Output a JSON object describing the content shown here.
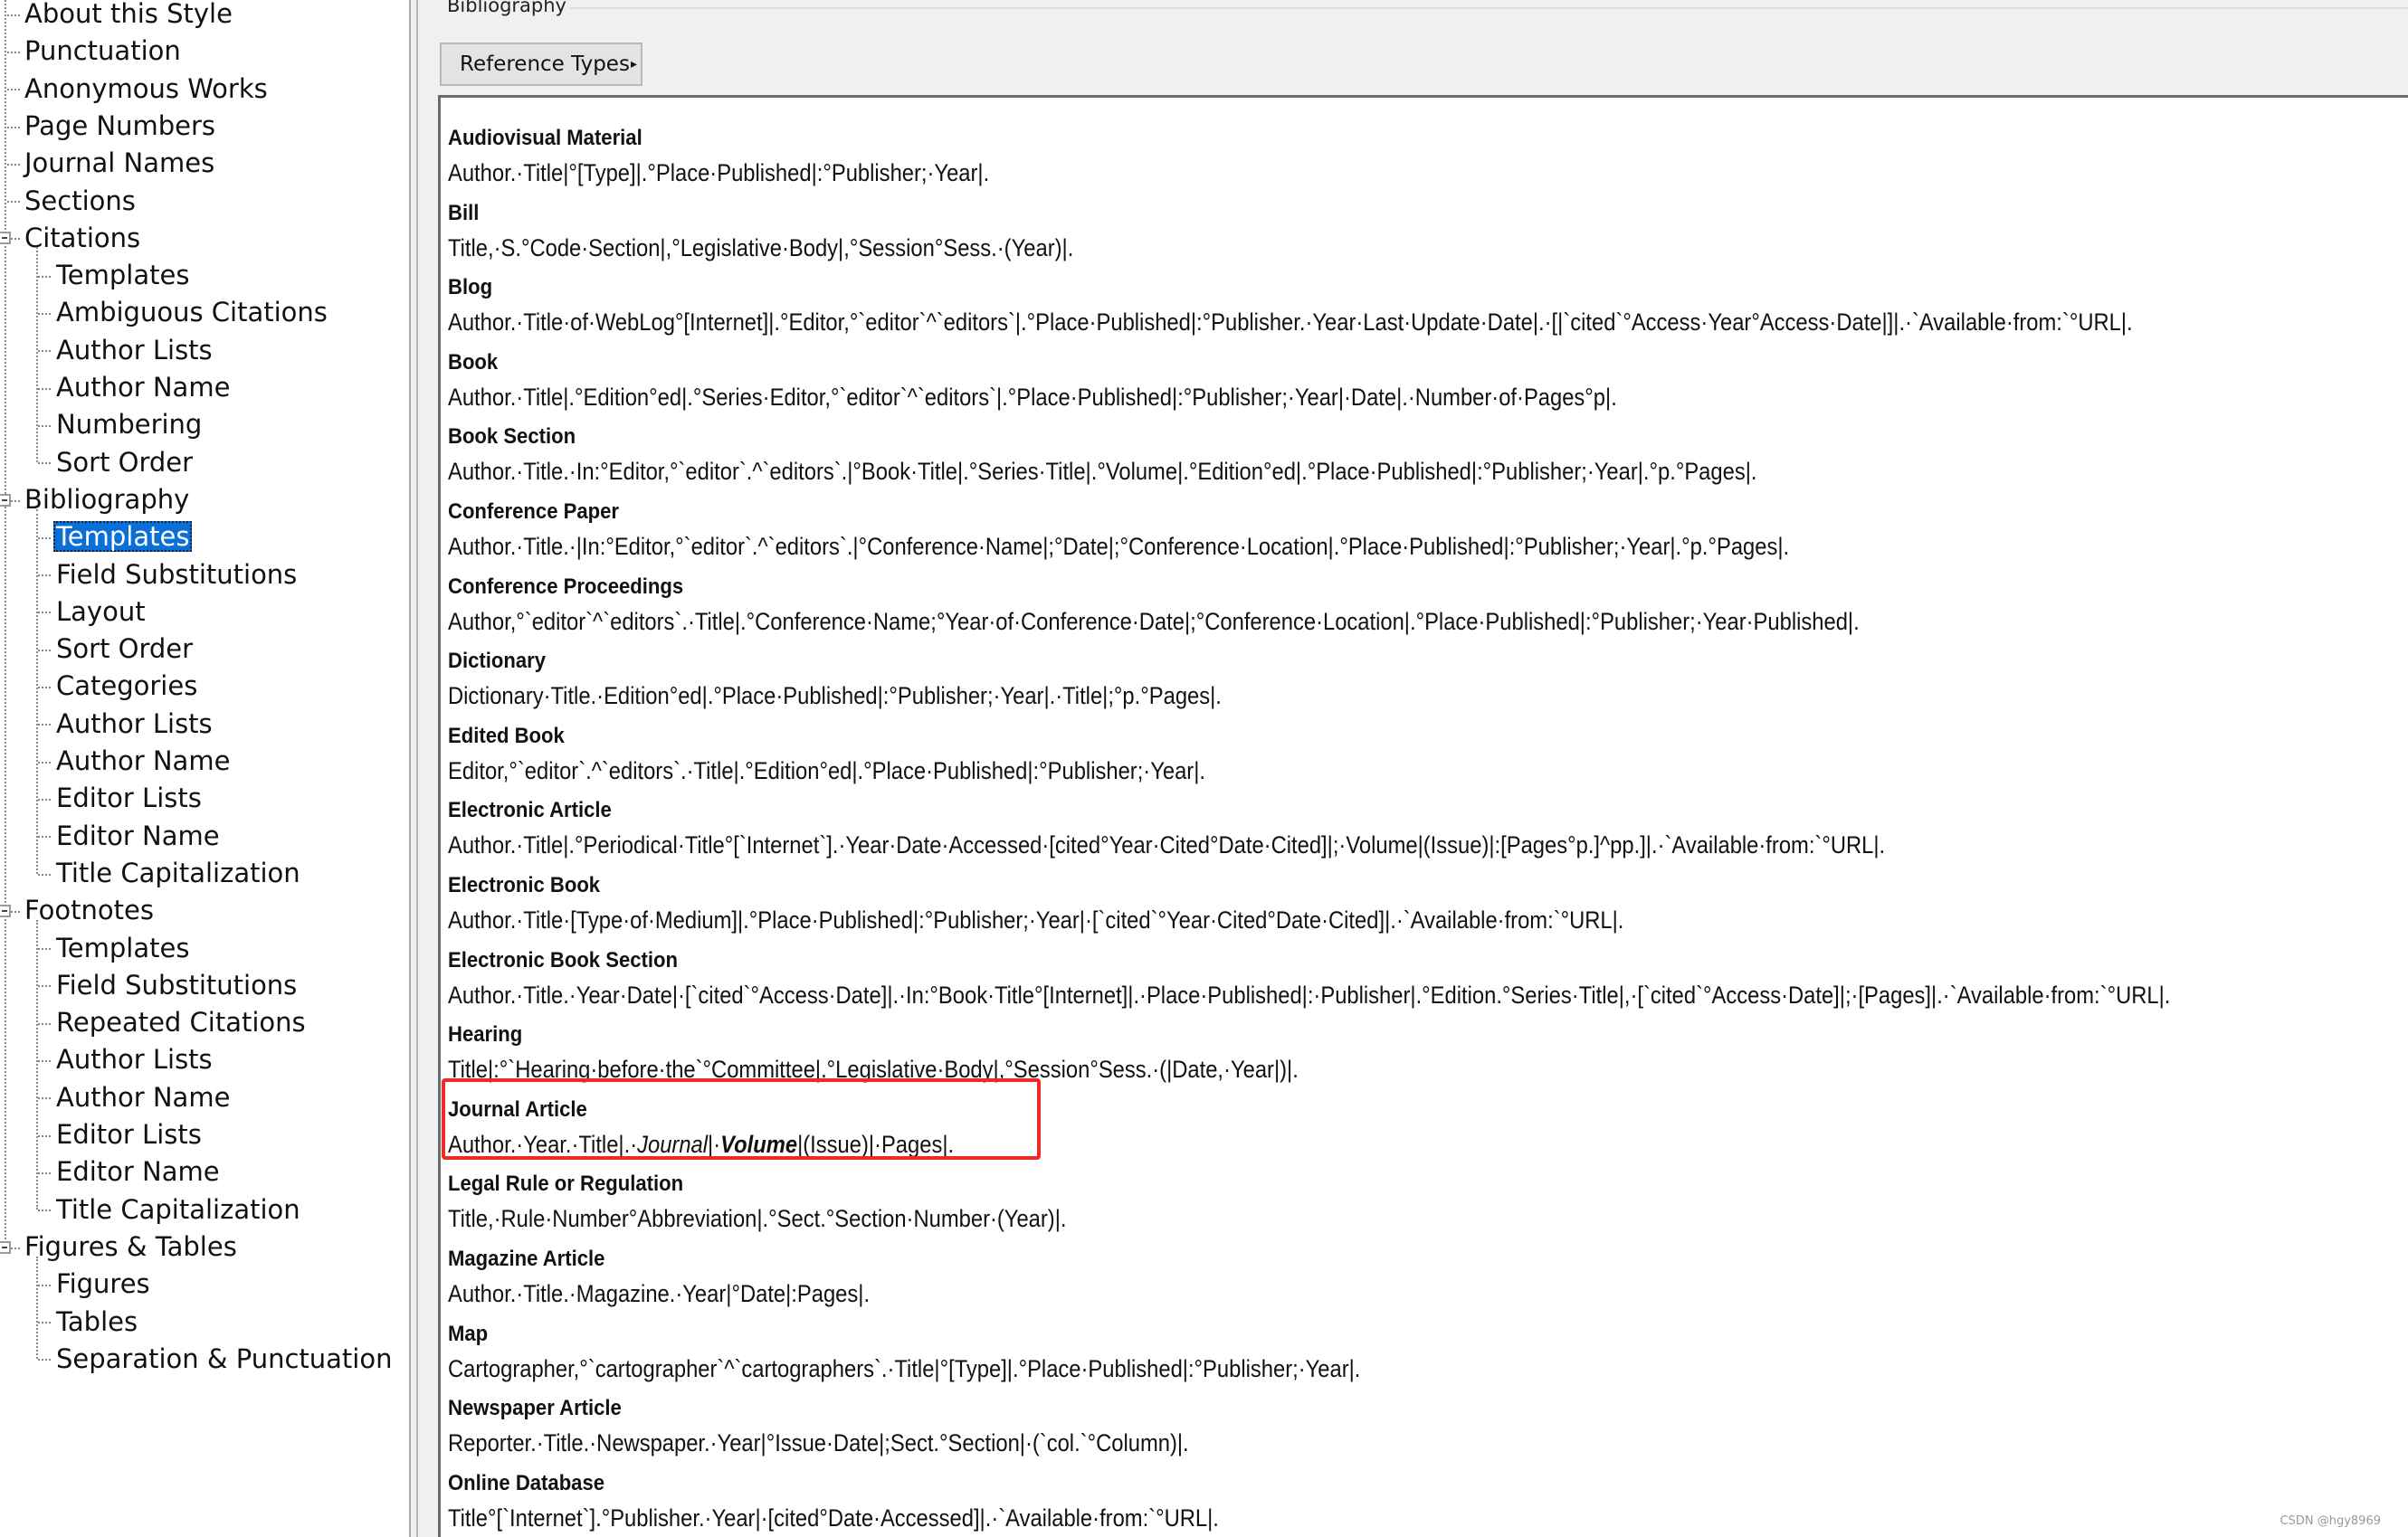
{
  "tree": {
    "items": [
      {
        "label": "About this Style",
        "level": 1
      },
      {
        "label": "Punctuation",
        "level": 1
      },
      {
        "label": "Anonymous Works",
        "level": 1
      },
      {
        "label": "Page Numbers",
        "level": 1
      },
      {
        "label": "Journal Names",
        "level": 1
      },
      {
        "label": "Sections",
        "level": 1
      },
      {
        "label": "Citations",
        "level": 1,
        "expanded": true
      },
      {
        "label": "Templates",
        "level": 2
      },
      {
        "label": "Ambiguous Citations",
        "level": 2
      },
      {
        "label": "Author Lists",
        "level": 2
      },
      {
        "label": "Author Name",
        "level": 2
      },
      {
        "label": "Numbering",
        "level": 2
      },
      {
        "label": "Sort Order",
        "level": 2
      },
      {
        "label": "Bibliography",
        "level": 1,
        "expanded": true
      },
      {
        "label": "Templates",
        "level": 2,
        "selected": true
      },
      {
        "label": "Field Substitutions",
        "level": 2
      },
      {
        "label": "Layout",
        "level": 2
      },
      {
        "label": "Sort Order",
        "level": 2
      },
      {
        "label": "Categories",
        "level": 2
      },
      {
        "label": "Author Lists",
        "level": 2
      },
      {
        "label": "Author Name",
        "level": 2
      },
      {
        "label": "Editor Lists",
        "level": 2
      },
      {
        "label": "Editor Name",
        "level": 2
      },
      {
        "label": "Title Capitalization",
        "level": 2
      },
      {
        "label": "Footnotes",
        "level": 1,
        "expanded": true
      },
      {
        "label": "Templates",
        "level": 2
      },
      {
        "label": "Field Substitutions",
        "level": 2
      },
      {
        "label": "Repeated Citations",
        "level": 2
      },
      {
        "label": "Author Lists",
        "level": 2
      },
      {
        "label": "Author Name",
        "level": 2
      },
      {
        "label": "Editor Lists",
        "level": 2
      },
      {
        "label": "Editor Name",
        "level": 2
      },
      {
        "label": "Title Capitalization",
        "level": 2
      },
      {
        "label": "Figures & Tables",
        "level": 1,
        "expanded": true
      },
      {
        "label": "Figures",
        "level": 2
      },
      {
        "label": "Tables",
        "level": 2
      },
      {
        "label": "Separation & Punctuation",
        "level": 2
      }
    ]
  },
  "panel": {
    "group_title": "Bibliography",
    "reference_types_button": "Reference Types",
    "reference_types_arrow": "▸"
  },
  "templates": [
    {
      "type": "Audiovisual Material",
      "template": "Author.·Title|°[Type]|.°Place·Published|:°Publisher;·Year|."
    },
    {
      "type": "Bill",
      "template": "Title,·S.°Code·Section|,°Legislative·Body|,°Session°Sess.·(Year)|."
    },
    {
      "type": "Blog",
      "template": "Author.·Title·of·WebLog°[Internet]|.°Editor,°`editor`^`editors`|.°Place·Published|:°Publisher.·Year·Last·Update·Date|.·[|`cited`°Access·Year°Access·Date|]|.·`Available·from:`°URL|."
    },
    {
      "type": "Book",
      "template": "Author.·Title|.°Edition°ed|.°Series·Editor,°`editor`^`editors`|.°Place·Published|:°Publisher;·Year|·Date|.·Number·of·Pages°p|."
    },
    {
      "type": "Book Section",
      "template": "Author.·Title.·In:°Editor,°`editor`.^`editors`.|°Book·Title|.°Series·Title|.°Volume|.°Edition°ed|.°Place·Published|:°Publisher;·Year|.°p.°Pages|."
    },
    {
      "type": "Conference Paper",
      "template": "Author.·Title.·|In:°Editor,°`editor`.^`editors`.|°Conference·Name|;°Date|;°Conference·Location|.°Place·Published|:°Publisher;·Year|.°p.°Pages|."
    },
    {
      "type": "Conference Proceedings",
      "template": "Author,°`editor`^`editors`.·Title|.°Conference·Name;°Year·of·Conference·Date|;°Conference·Location|.°Place·Published|:°Publisher;·Year·Published|."
    },
    {
      "type": "Dictionary",
      "template": "Dictionary·Title.·Edition°ed|.°Place·Published|:°Publisher;·Year|.·Title|;°p.°Pages|."
    },
    {
      "type": "Edited Book",
      "template": "Editor,°`editor`.^`editors`.·Title|.°Edition°ed|.°Place·Published|:°Publisher;·Year|."
    },
    {
      "type": "Electronic Article",
      "template": "Author.·Title|.°Periodical·Title°[`Internet`].·Year·Date·Accessed·[cited°Year·Cited°Date·Cited]|;·Volume|(Issue)|:[Pages°p.]^pp.]|.·`Available·from:`°URL|."
    },
    {
      "type": "Electronic Book",
      "template": "Author.·Title·[Type·of·Medium]|.°Place·Published|:°Publisher;·Year|·[`cited`°Year·Cited°Date·Cited]|.·`Available·from:`°URL|."
    },
    {
      "type": "Electronic Book Section",
      "template": "Author.·Title.·Year·Date|·[`cited`°Access·Date]|.·In:°Book·Title°[Internet]|.·Place·Published|:·Publisher|.°Edition.°Series·Title|,·[`cited`°Access·Date]|;·[Pages]|.·`Available·from:`°URL|."
    },
    {
      "type": "Hearing",
      "template": "Title|:°`Hearing·before·the`°Committee|.°Legislative·Body|,°Session°Sess.·(|Date,·Year|)|."
    },
    {
      "type": "Journal Article",
      "template_parts": [
        {
          "text": "Author.·Year.·Title|.·",
          "style": "normal"
        },
        {
          "text": "Journal",
          "style": "italic"
        },
        {
          "text": "|·",
          "style": "normal"
        },
        {
          "text": "Volume",
          "style": "bold-italic"
        },
        {
          "text": "|(Issue)|·Pages|.",
          "style": "normal"
        }
      ],
      "highlighted": true
    },
    {
      "type": "Legal Rule or Regulation",
      "template": "Title,·Rule·Number°Abbreviation|.°Sect.°Section·Number·(Year)|."
    },
    {
      "type": "Magazine Article",
      "template": "Author.·Title.·Magazine.·Year|°Date|:Pages|."
    },
    {
      "type": "Map",
      "template": "Cartographer,°`cartographer`^`cartographers`.·Title|°[Type]|.°Place·Published|:°Publisher;·Year|."
    },
    {
      "type": "Newspaper Article",
      "template": "Reporter.·Title.·Newspaper.·Year|°Issue·Date|;Sect.°Section|·(`col.`°Column)|."
    },
    {
      "type": "Online Database",
      "template": "Title°[`Internet`].°Publisher.·Year|·[cited°Date·Accessed]|.·`Available·from:`°URL|."
    }
  ],
  "colors": {
    "selection": "#0a6fd6",
    "highlight_box": "#ee2a24",
    "panel_bg": "#f0eff1"
  },
  "watermark": "CSDN @hgy8969"
}
